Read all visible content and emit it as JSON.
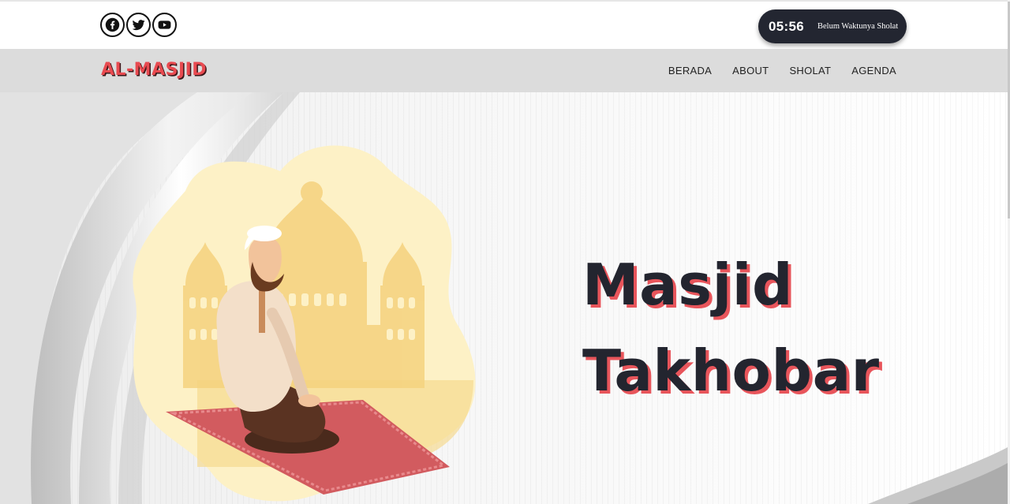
{
  "topbar": {
    "socials": [
      {
        "icon": "facebook-icon",
        "label": "Facebook"
      },
      {
        "icon": "twitter-icon",
        "label": "Twitter"
      },
      {
        "icon": "youtube-icon",
        "label": "YouTube"
      }
    ],
    "prayer": {
      "time": "05:56",
      "status": "Belum Waktunya Sholat"
    }
  },
  "navbar": {
    "logo": "AL-MASJID",
    "menu": [
      "BERADA",
      "ABOUT",
      "SHOLAT",
      "AGENDA"
    ]
  },
  "hero": {
    "title_line1": "Masjid",
    "title_line2": "Takhobar",
    "illustration": "man-praying-on-rug-before-mosque"
  },
  "colors": {
    "accent": "#e84a50",
    "dark": "#23252f",
    "navbar_bg": "#dcdcdc",
    "illustration_yellow": "#fde7a4"
  }
}
